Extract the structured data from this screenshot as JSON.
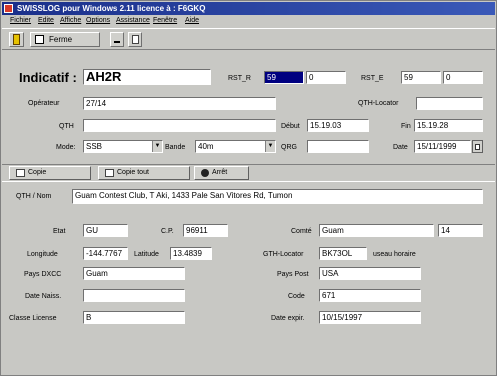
{
  "window": {
    "title": "SWISSLOG pour Windows 2.11 licence à : F6GKQ"
  },
  "menu": [
    "Fichier",
    "Edite",
    "Affiche",
    "Options",
    "Assistance",
    "Fenêtre",
    "Aide"
  ],
  "toolbar": {
    "close_label": "Ferme"
  },
  "fields": {
    "indicatif_label": "Indicatif :",
    "indicatif": "AH2R",
    "rst_r_label": "RST_R",
    "rst_r": "59",
    "rst_r2": "0",
    "rst_e_label": "RST_E",
    "rst_e": "59",
    "rst_e2": "0",
    "operateur_label": "Opérateur",
    "operateur": "27/14",
    "qth_locator_label": "QTH-Locator",
    "qth_locator": "",
    "qth_label": "QTH",
    "qth": "",
    "debut_label": "Début",
    "debut": "15.19.03",
    "fin_label": "Fin",
    "fin": "15.19.28",
    "mode_label": "Mode:",
    "mode": "SSB",
    "bande_label": "Bande",
    "bande": "40m",
    "qrg_label": "QRG",
    "qrg": "",
    "date_label": "Date",
    "date": "15/11/1999"
  },
  "buttons": {
    "copie": "Copie",
    "copie_tout": "Copie tout",
    "arret": "Arrêt"
  },
  "info": {
    "qth_nom_label": "QTH / Nom",
    "qth_nom": "Guam Contest Club, T Aki, 1433 Pale San Vitores Rd, Tumon",
    "etat_label": "Etat",
    "etat": "GU",
    "cp_label": "C.P.",
    "cp": "96911",
    "comte_label": "Comté",
    "comte": "Guam",
    "comte2": "14",
    "longitude_label": "Longitude",
    "longitude": "-144.7767",
    "latitude_label": "Latitude",
    "latitude": "13.4839",
    "gth_locator_label": "GTH-Locator",
    "gth_locator": "BK73OL",
    "fuseau_label": "useau horaire",
    "pays_dxcc_label": "Pays DXCC",
    "pays_dxcc": "Guam",
    "pays_post_label": "Pays Post",
    "pays_post": "USA",
    "date_naiss_label": "Date Naiss.",
    "date_naiss": "",
    "code_label": "Code",
    "code": "671",
    "classe_label": "Classe License",
    "classe": "B",
    "date_expir_label": "Date expir.",
    "date_expir": "10/15/1997"
  }
}
